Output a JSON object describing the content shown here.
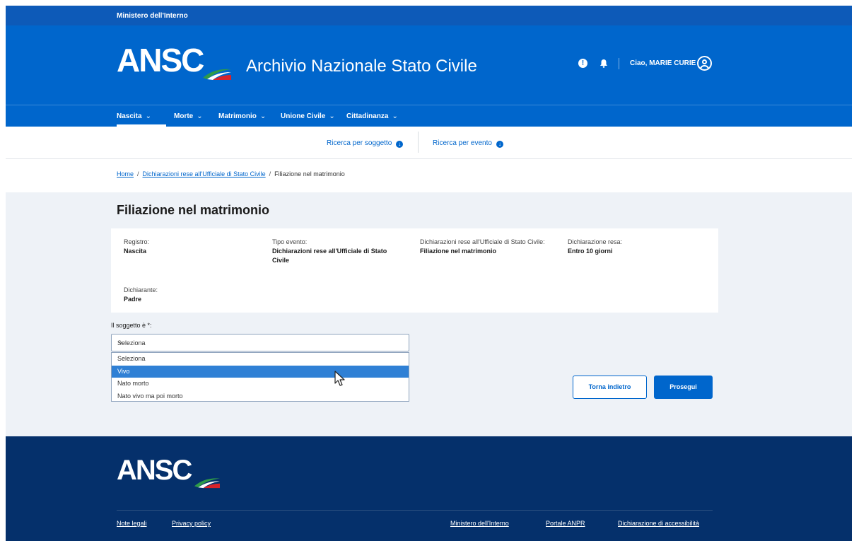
{
  "header": {
    "ministry": "Ministero dell'Interno",
    "logo_text": "ANSC",
    "app_title": "Archivio Nazionale Stato Civile",
    "greeting": "Ciao,  MARIE CURIE",
    "alert_icon": "exclamation-circle-icon",
    "bell_icon": "bell-icon",
    "user_icon": "user-circle-icon"
  },
  "nav": {
    "items": [
      {
        "label": "Nascita"
      },
      {
        "label": "Morte"
      },
      {
        "label": "Matrimonio"
      },
      {
        "label": "Unione Civile"
      },
      {
        "label": "Cittadinanza"
      }
    ],
    "active": "Nascita"
  },
  "subnav": {
    "by_subject": "Ricerca per soggetto",
    "by_event": "Ricerca per evento"
  },
  "breadcrumb": {
    "home": "Home",
    "section": "Dichiarazioni rese all'Ufficiale di Stato Civile",
    "current": "Filiazione nel matrimonio",
    "separator": "/"
  },
  "page": {
    "title": "Filiazione nel matrimonio"
  },
  "summary": {
    "registro_label": "Registro:",
    "registro_value": "Nascita",
    "tipo_label": "Tipo evento:",
    "tipo_value_line1": "Dichiarazioni rese all'Ufficiale di Stato",
    "tipo_value_line2": "Civile",
    "dich_label": "Dichiarazioni rese all'Ufficiale di Stato Civile:",
    "dich_value": "Filiazione nel matrimonio",
    "resa_label": "Dichiarazione resa:",
    "resa_value": "Entro 10 giorni",
    "dichiarante_label": "Dichiarante:",
    "dichiarante_value": "Padre"
  },
  "form": {
    "subject_label": "Il soggetto è *:",
    "select_value": "Seleziona",
    "options": [
      "Seleziona",
      "Vivo",
      "Nato morto",
      "Nato vivo ma poi morto"
    ],
    "highlighted_option": "Vivo"
  },
  "actions": {
    "back": "Torna indietro",
    "next": "Prosegui"
  },
  "footer": {
    "logo_text": "ANSC",
    "links": [
      "Note legali",
      "Privacy policy",
      "Ministero dell'Interno",
      "Portale ANPR",
      "Dichiarazione di accessibilità"
    ]
  },
  "colors": {
    "primary": "#0066cc",
    "slim_header": "#0d5ab8",
    "footer": "#05306b",
    "highlight": "#2f80d5"
  }
}
